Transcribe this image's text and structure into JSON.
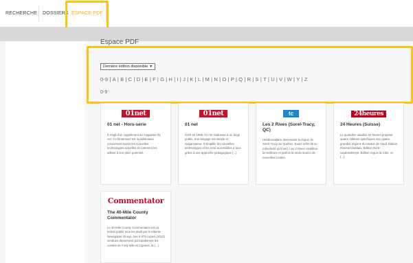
{
  "nav": {
    "items": [
      "RECHERCHE",
      "DOSSIERS",
      "ESPACE PDF"
    ]
  },
  "page": {
    "title": "Espace PDF",
    "select_value": "Dernière édition disponible",
    "alphabet": [
      "0-9",
      "A",
      "B",
      "C",
      "D",
      "E",
      "F",
      "G",
      "H",
      "I",
      "J",
      "K",
      "L",
      "M",
      "N",
      "O",
      "P",
      "Q",
      "R",
      "S",
      "T",
      "U",
      "V",
      "W",
      "Y",
      "Z"
    ],
    "section_label": "0-9"
  },
  "cards": [
    {
      "logo": "01net",
      "title": "01 net - Hors-série",
      "desc": "Il s'agit d'un supplément au magazine 01 net. Ce bimensuel est la publication concernant toutes les nouvelles technologies actuelles et comment les utiliser à leur plein potentiel."
    },
    {
      "logo": "01net",
      "title": "01 net",
      "desc": "Créé en 1998, 01 net s'adresse à un large public. Son langage est simple et vulgarisateur. Il simplifie les nouvelles technologies et les rend accessibles à tous grâce à une approche pédagogique (...)"
    },
    {
      "logo": "tc",
      "title": "Les 2 Rives (Sorel-Tracy, QC)",
      "desc": "Hebdomadaire desservant la région de Sorel-Tracy au Québec. Exact reflet de la collectivité qu'il sert, Les 2 Rives constitue la meilleure et parfois la seule source de nouvelles locales."
    },
    {
      "logo": "24heures",
      "title": "24 Heures (Suisse)",
      "desc": "Le quotidien vaudois 24 heures propose quatre éditions spécifiques aux quatre grandes régions du canton de Vaud: Édition Riviera/Chablais, Édition Nord-vaudois/Broye, Édition région la Côte, et (...)"
    },
    {
      "logo": "Commentator",
      "title": "The 40-Mile County Commentator",
      "desc": "Le 40-Mile County Commentator est un hebdo publié tous les jeudi par le Alberta Newspaper Group. Ses 6 879 copies (2012) vendues desservent principalement les comtés de Forty Mile et Cypress, la (...)"
    }
  ],
  "colors": {
    "accent": "#ffc20e",
    "active_nav": "#f2b01e",
    "logo_red": "#c8102e",
    "logo_blue": "#1a88c9"
  }
}
